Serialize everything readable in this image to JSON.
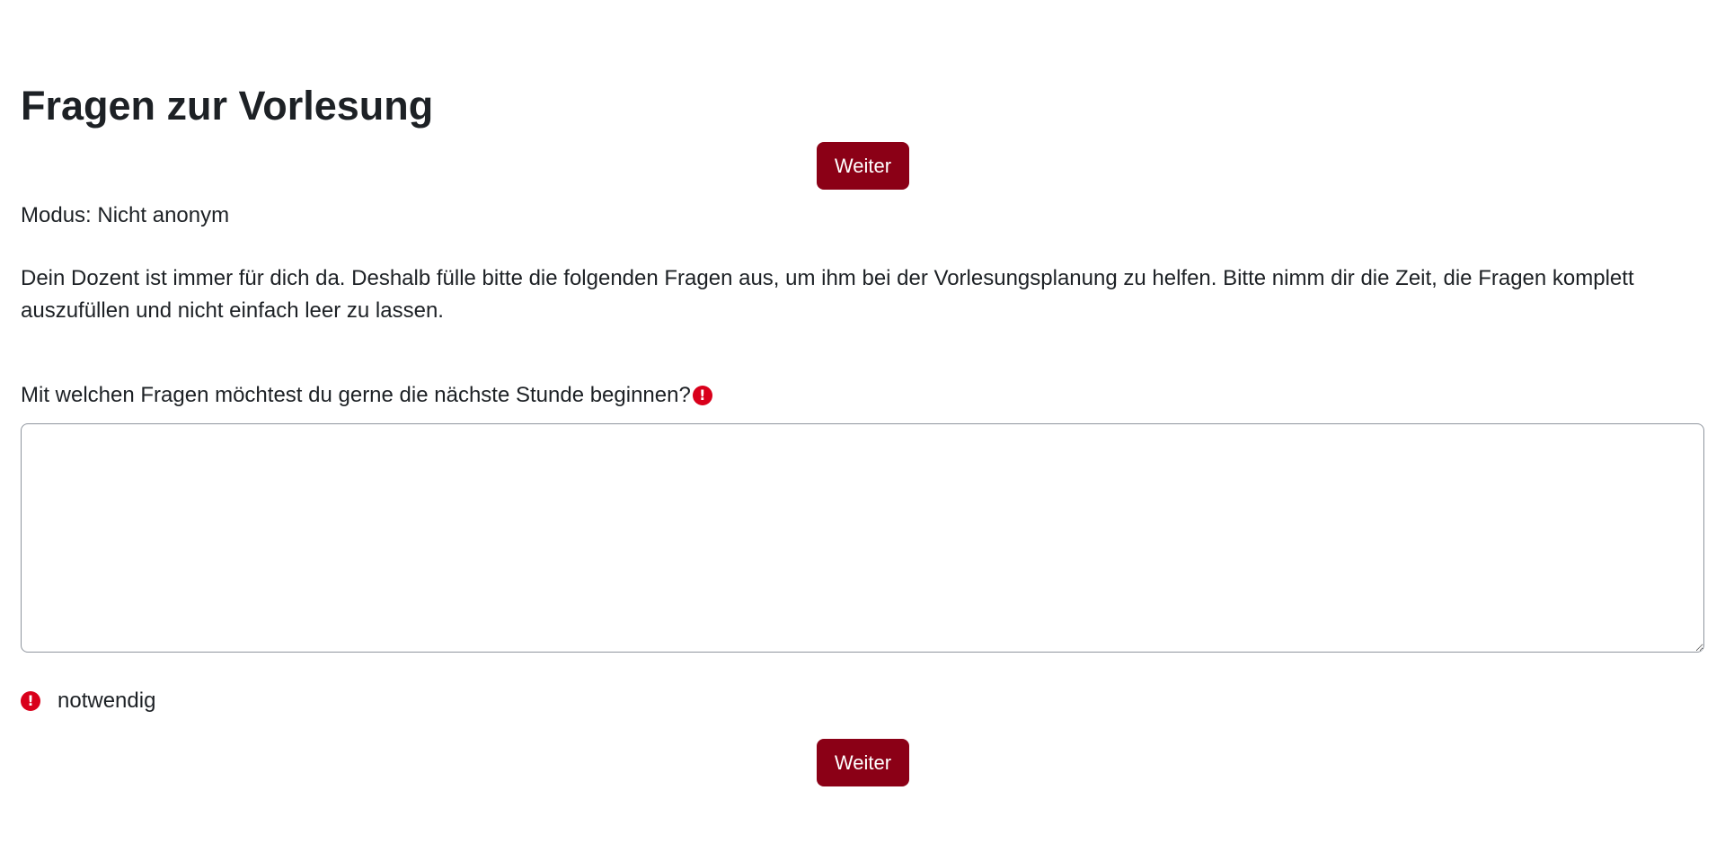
{
  "header": {
    "title": "Fragen zur Vorlesung"
  },
  "navigation": {
    "next_label_top": "Weiter",
    "next_label_bottom": "Weiter"
  },
  "info": {
    "mode": "Modus: Nicht anonym",
    "intro": "Dein Dozent ist immer für dich da. Deshalb fülle bitte die folgenden Fragen aus, um ihm bei der Vorlesungsplanung zu helfen. Bitte nimm dir die Zeit, die Fragen komplett auszufüllen und nicht einfach leer zu lassen."
  },
  "question": {
    "label": "Mit welchen Fragen möchtest du gerne die nächste Stunde beginnen?",
    "value": "",
    "required_icon": "exclamation-circle-icon"
  },
  "legend": {
    "required_label": "notwendig",
    "required_icon": "exclamation-circle-icon"
  },
  "colors": {
    "accent": "#8b0016",
    "required": "#d9001b",
    "text": "#1d2125"
  }
}
